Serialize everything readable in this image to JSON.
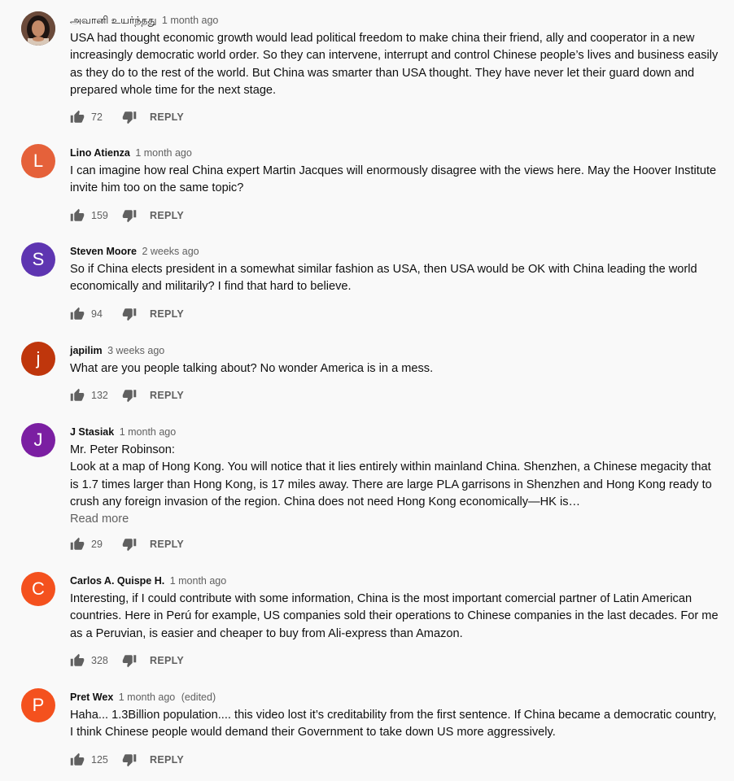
{
  "icons": {
    "like": "thumb-up-icon",
    "dislike": "thumb-down-icon"
  },
  "reply_label": "REPLY",
  "read_more_label": "Read more",
  "comments": [
    {
      "author": "அவானி உயர்ந்தது",
      "time": "1 month ago",
      "text": "USA had thought economic growth would lead political freedom to make china their friend, ally and cooperator in a new increasingly democratic world order. So they can intervene, interrupt and control Chinese people’s lives and business easily as they do to the rest of the world. But China was smarter than USA thought. They have never let their guard down and prepared whole time for the next stage.",
      "likes": "72",
      "avatar_photo": true
    },
    {
      "author": "Lino Atienza",
      "time": "1 month ago",
      "text": "I can imagine how real China expert Martin Jacques will enormously disagree with the views here. May the Hoover Institute invite him too on the same topic?",
      "likes": "159",
      "initial": "L",
      "color": "#e5613a"
    },
    {
      "author": "Steven Moore",
      "time": "2 weeks ago",
      "text": "So if China elects president in a somewhat similar fashion as USA,  then USA would be OK with China leading the world economically and militarily?  I find that hard to believe.",
      "likes": "94",
      "initial": "S",
      "color": "#5e35b1"
    },
    {
      "author": "japilim",
      "time": "3 weeks ago",
      "text": "What are you people talking about? No wonder America is in a mess.",
      "likes": "132",
      "initial": "j",
      "color": "#bf360c"
    },
    {
      "author": "J Stasiak",
      "time": "1 month ago",
      "text": "Mr. Peter Robinson:\nLook at a map of Hong Kong. You will notice that it lies entirely within mainland China. Shenzhen, a Chinese megacity that is 1.7 times larger than Hong Kong, is 17 miles away. There are large PLA garrisons in Shenzhen and Hong Kong ready to crush any foreign invasion of the region. China does not need Hong Kong economically—HK is…",
      "likes": "29",
      "initial": "J",
      "color": "#7b1fa2",
      "truncated": true
    },
    {
      "author": "Carlos A. Quispe H.",
      "time": "1 month ago",
      "text": "Interesting, if I could contribute with some information, China is the most important comercial partner of Latin American countries. Here in Perú for example, US companies sold their operations to Chinese companies in the last decades. For me as a Peruvian, is easier and cheaper to buy from Ali-express than Amazon.",
      "likes": "328",
      "initial": "C",
      "color": "#f4511e"
    },
    {
      "author": "Pret Wex",
      "time": "1 month ago",
      "edited": "(edited)",
      "text": "Haha... 1.3Billion population.... this video lost it’s creditability from the first sentence. If China became a democratic country, I think Chinese people would demand their Government to take down US more aggressively.",
      "likes": "125",
      "initial": "P",
      "color": "#f4511e"
    }
  ]
}
